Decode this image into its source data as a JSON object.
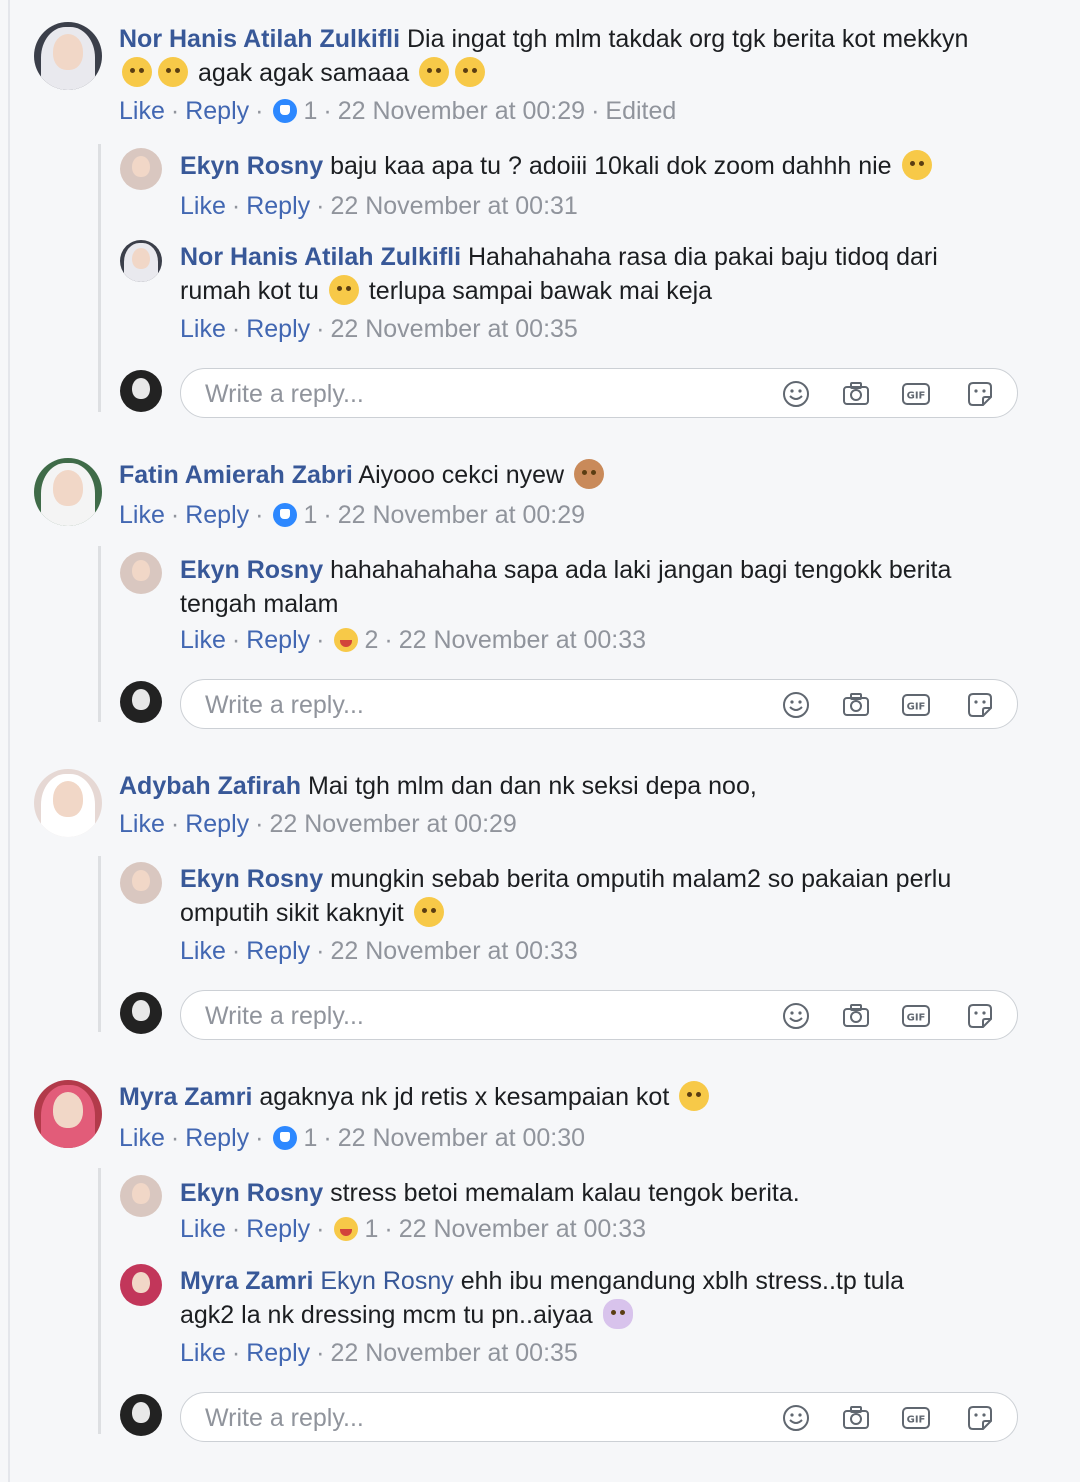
{
  "labels": {
    "like": "Like",
    "reply": "Reply",
    "write_reply_placeholder": "Write a reply...",
    "edited": "Edited",
    "separator": "·"
  },
  "threads": [
    {
      "comment": {
        "author": "Nor Hanis Atilah Zulkifli",
        "text_line1": "Dia ingat tgh mlm takdak org tgk berita kot mekkyn",
        "text_line2": "agak agak samaaa",
        "time": "22 November at 00:29",
        "reaction_count": "1",
        "edited": "Edited"
      },
      "replies": [
        {
          "author": "Ekyn Rosny",
          "text_line1": "baju kaa apa tu ? adoiii 10kali dok zoom dahhh nie",
          "text_line2": "",
          "time": "22 November at 00:31"
        },
        {
          "author": "Nor Hanis Atilah Zulkifli",
          "text_line1": "Hahahahaha rasa dia pakai baju tidoq dari",
          "text_line2": "rumah kot tu",
          "text_line2b": "terlupa sampai bawak mai keja",
          "time": "22 November at 00:35"
        }
      ]
    },
    {
      "comment": {
        "author": "Fatin Amierah Zabri",
        "text_line1": "Aiyooo cekci nyew",
        "time": "22 November at 00:29",
        "reaction_count": "1"
      },
      "replies": [
        {
          "author": "Ekyn Rosny",
          "text_line1": "hahahahahaha sapa ada laki jangan bagi tengokk berita",
          "text_line2": "tengah malam",
          "time": "22 November at 00:33",
          "reaction_count": "2"
        }
      ]
    },
    {
      "comment": {
        "author": "Adybah Zafirah",
        "text_line1": "Mai tgh mlm dan dan nk seksi depa noo,",
        "time": "22 November at 00:29"
      },
      "replies": [
        {
          "author": "Ekyn Rosny",
          "text_line1": "mungkin sebab berita omputih malam2 so pakaian perlu",
          "text_line2": "omputih sikit kaknyit",
          "time": "22 November at 00:33"
        }
      ]
    },
    {
      "comment": {
        "author": "Myra Zamri",
        "text_line1": "agaknya nk jd retis x kesampaian kot",
        "time": "22 November at 00:30",
        "reaction_count": "1"
      },
      "replies": [
        {
          "author": "Ekyn Rosny",
          "text_line1": "stress betoi memalam kalau tengok berita.",
          "time": "22 November at 00:33",
          "reaction_count": "1"
        },
        {
          "author": "Myra Zamri",
          "mention": "Ekyn Rosny",
          "text_line1": "ehh ibu mengandung xblh stress..tp tula",
          "text_line2": "agk2 la nk dressing mcm tu pn..aiyaa",
          "time": "22 November at 00:35"
        }
      ]
    }
  ],
  "icons": {
    "emoji_button": "smiley-icon",
    "photo_button": "camera-icon",
    "gif_button": "gif-icon",
    "sticker_button": "sticker-icon"
  },
  "colors": {
    "name": "#385898",
    "link": "#4267b2",
    "meta": "#90949c",
    "background": "#f6f7f9"
  }
}
